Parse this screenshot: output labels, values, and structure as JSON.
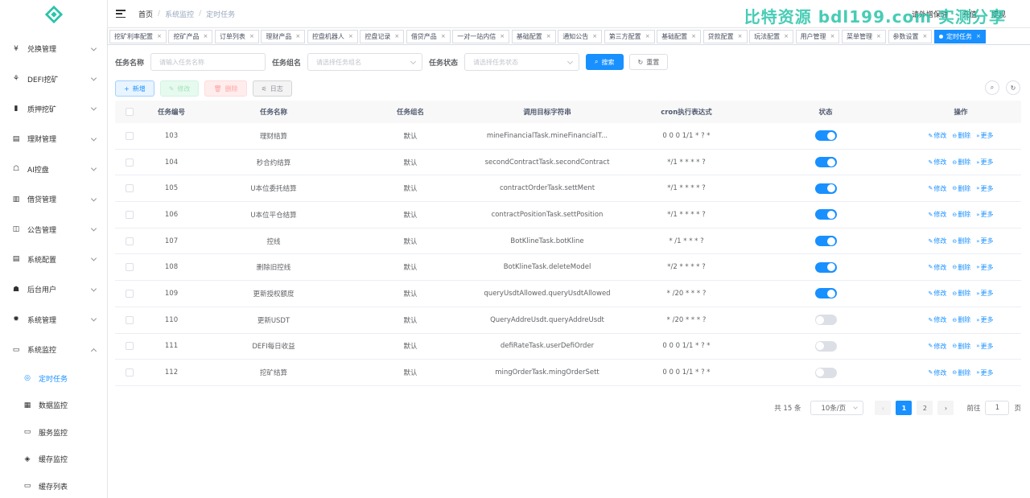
{
  "header": {
    "breadcrumb": [
      "首页",
      "系统监控",
      "定时任务"
    ],
    "right_items": [
      "请外增保驻",
      "充值",
      "提现"
    ],
    "watermark": "比特资源 bdl199.com 实测分享"
  },
  "sidebar": {
    "items": [
      {
        "label": "兑换管理",
        "icon": "¥"
      },
      {
        "label": "DEFI挖矿",
        "icon": "⚘"
      },
      {
        "label": "质押挖矿",
        "icon": "▮"
      },
      {
        "label": "理财管理",
        "icon": "▤"
      },
      {
        "label": "AI控盘",
        "icon": "☖"
      },
      {
        "label": "借贷管理",
        "icon": "▥"
      },
      {
        "label": "公告管理",
        "icon": "◫"
      },
      {
        "label": "系统配置",
        "icon": "▤"
      },
      {
        "label": "后台用户",
        "icon": "☗"
      },
      {
        "label": "系统管理",
        "icon": "✹"
      },
      {
        "label": "系统监控",
        "icon": "▭"
      }
    ],
    "sub_items": [
      {
        "label": "定时任务",
        "icon": "◎"
      },
      {
        "label": "数据监控",
        "icon": "▦"
      },
      {
        "label": "服务监控",
        "icon": "▭"
      },
      {
        "label": "缓存监控",
        "icon": "◈"
      },
      {
        "label": "缓存列表",
        "icon": "▭"
      }
    ]
  },
  "tags": [
    "挖矿利率配置",
    "挖矿产品",
    "订单列表",
    "理财产品",
    "控盘机器人",
    "控盘记录",
    "借贷产品",
    "一对一站内信",
    "基础配置",
    "通知公告",
    "第三方配置",
    "基础配置",
    "贷款配置",
    "玩法配置",
    "用户管理",
    "菜单管理",
    "参数设置"
  ],
  "active_tag": "定时任务",
  "search": {
    "task_name_label": "任务名称",
    "task_name_placeholder": "请输入任务名称",
    "task_group_label": "任务组名",
    "task_group_placeholder": "请选择任务组名",
    "task_status_label": "任务状态",
    "task_status_placeholder": "请选择任务状态",
    "search_btn": "搜索",
    "reset_btn": "重置"
  },
  "toolbar": {
    "add": "新增",
    "edit": "修改",
    "delete": "删除",
    "log": "日志"
  },
  "table": {
    "headers": [
      "任务编号",
      "任务名称",
      "任务组名",
      "调用目标字符串",
      "cron执行表达式",
      "状态",
      "操作"
    ],
    "op_labels": {
      "edit": "修改",
      "delete": "删除",
      "more": "更多"
    },
    "rows": [
      {
        "id": "103",
        "name": "理财结算",
        "group": "默认",
        "target": "mineFinancialTask.mineFinancialT...",
        "cron": "0 0 0 1/1 * ? *",
        "enabled": true
      },
      {
        "id": "104",
        "name": "秒合约结算",
        "group": "默认",
        "target": "secondContractTask.secondContract",
        "cron": "*/1 * * * * ?",
        "enabled": true
      },
      {
        "id": "105",
        "name": "U本位委托结算",
        "group": "默认",
        "target": "contractOrderTask.settMent",
        "cron": "*/1 * * * * ?",
        "enabled": true
      },
      {
        "id": "106",
        "name": "U本位平仓结算",
        "group": "默认",
        "target": "contractPositionTask.settPosition",
        "cron": "*/1 * * * * ?",
        "enabled": true
      },
      {
        "id": "107",
        "name": "控线",
        "group": "默认",
        "target": "BotKlineTask.botKline",
        "cron": "* /1 * * * ?",
        "enabled": true
      },
      {
        "id": "108",
        "name": "删除旧控线",
        "group": "默认",
        "target": "BotKlineTask.deleteModel",
        "cron": "*/2 * * * * ?",
        "enabled": true
      },
      {
        "id": "109",
        "name": "更新授权额度",
        "group": "默认",
        "target": "queryUsdtAllowed.queryUsdtAllowed",
        "cron": "* /20 * * * ?",
        "enabled": true
      },
      {
        "id": "110",
        "name": "更新USDT",
        "group": "默认",
        "target": "QueryAddreUsdt.queryAddreUsdt",
        "cron": "* /20 * * * ?",
        "enabled": false
      },
      {
        "id": "111",
        "name": "DEFI每日收益",
        "group": "默认",
        "target": "defiRateTask.userDefiOrder",
        "cron": "0 0 0 1/1 * ? *",
        "enabled": false
      },
      {
        "id": "112",
        "name": "挖矿结算",
        "group": "默认",
        "target": "mingOrderTask.mingOrderSett",
        "cron": "0 0 0 1/1 * ? *",
        "enabled": false
      }
    ]
  },
  "pagination": {
    "total_text": "共 15 条",
    "page_size": "10条/页",
    "pages": [
      "1",
      "2"
    ],
    "current": "1",
    "prev": "‹",
    "next": "›",
    "goto_label": "前往",
    "goto_value": "1",
    "page_suffix": "页"
  },
  "colors": {
    "primary": "#1890ff",
    "brand": "#29c4a9"
  }
}
